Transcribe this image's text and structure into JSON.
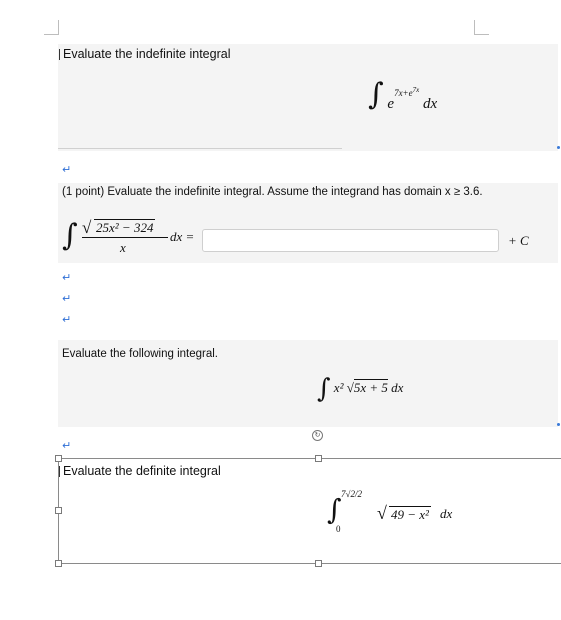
{
  "q1": {
    "prompt": "Evaluate the indefinite integral",
    "integral_symbol": "∫",
    "base": "e",
    "exponent": "7x+e",
    "exponent_sup": "7x",
    "differential": "dx"
  },
  "q2": {
    "prompt": "(1 point) Evaluate the indefinite integral. Assume the integrand has domain x ≥ 3.6.",
    "numerator": "25x² − 324",
    "denominator": "x",
    "equals": "dx =",
    "answer_value": "",
    "plus_c": "+ C"
  },
  "q3": {
    "prompt": "Evaluate the following integral.",
    "expression_pre": "x²",
    "radicand": "5x + 5",
    "differential": "dx"
  },
  "q4": {
    "prompt": "Evaluate the definite integral",
    "upper_limit": "7√2/2",
    "lower_limit": "0",
    "radicand": "49 − x²",
    "differential": "dx"
  },
  "marks": {
    "return": "↵"
  },
  "colors": {
    "block_bg": "#f4f4f4",
    "para_mark": "#2f6fd6"
  },
  "icons": {
    "rotate": "rotate-handle-icon"
  }
}
